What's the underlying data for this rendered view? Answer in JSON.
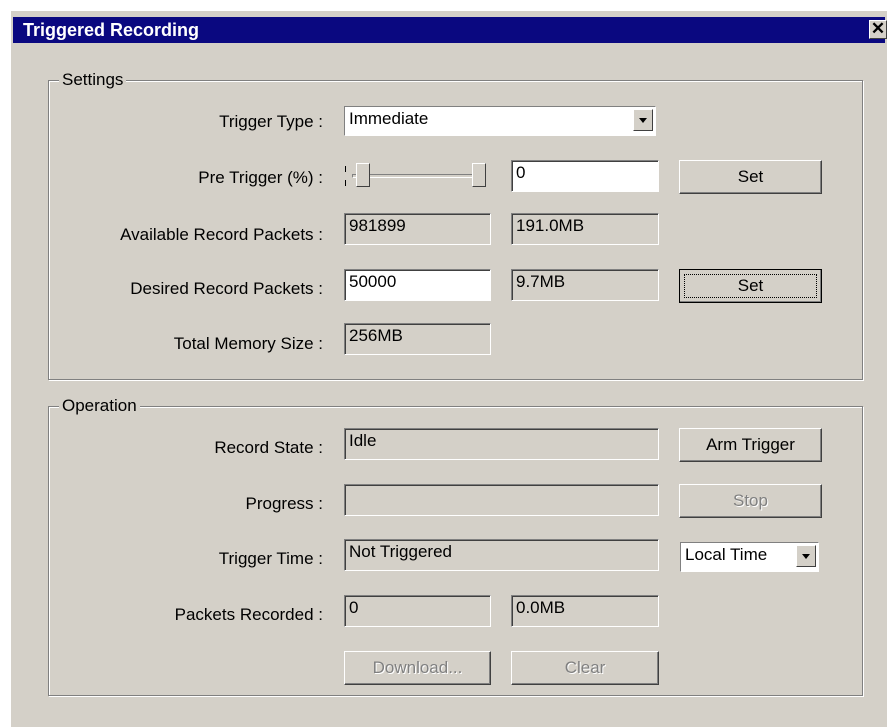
{
  "window": {
    "title": "Triggered Recording",
    "close_glyph": "✕"
  },
  "settings": {
    "legend": "Settings",
    "trigger_type": {
      "label": "Trigger Type :",
      "value": "Immediate"
    },
    "pre_trigger": {
      "label": "Pre Trigger (%) :",
      "slider_value": 0,
      "value": "0",
      "set_label": "Set"
    },
    "available": {
      "label": "Available Record Packets :",
      "packets": "981899",
      "size": "191.0MB"
    },
    "desired": {
      "label": "Desired Record Packets :",
      "packets": "50000",
      "size": "9.7MB",
      "set_label": "Set"
    },
    "total_memory": {
      "label": "Total Memory Size :",
      "value": "256MB"
    }
  },
  "operation": {
    "legend": "Operation",
    "record_state": {
      "label": "Record State :",
      "value": "Idle",
      "button": "Arm Trigger"
    },
    "progress": {
      "label": "Progress :",
      "value": "",
      "fraction": 0,
      "button": "Stop"
    },
    "trigger_time": {
      "label": "Trigger Time :",
      "value": "Not Triggered",
      "time_mode": "Local Time"
    },
    "packets_recorded": {
      "label": "Packets Recorded :",
      "packets": "0",
      "size": "0.0MB"
    },
    "download_label": "Download...",
    "clear_label": "Clear"
  },
  "icons": {
    "close": "close-icon",
    "dropdown": "chevron-down-icon"
  }
}
